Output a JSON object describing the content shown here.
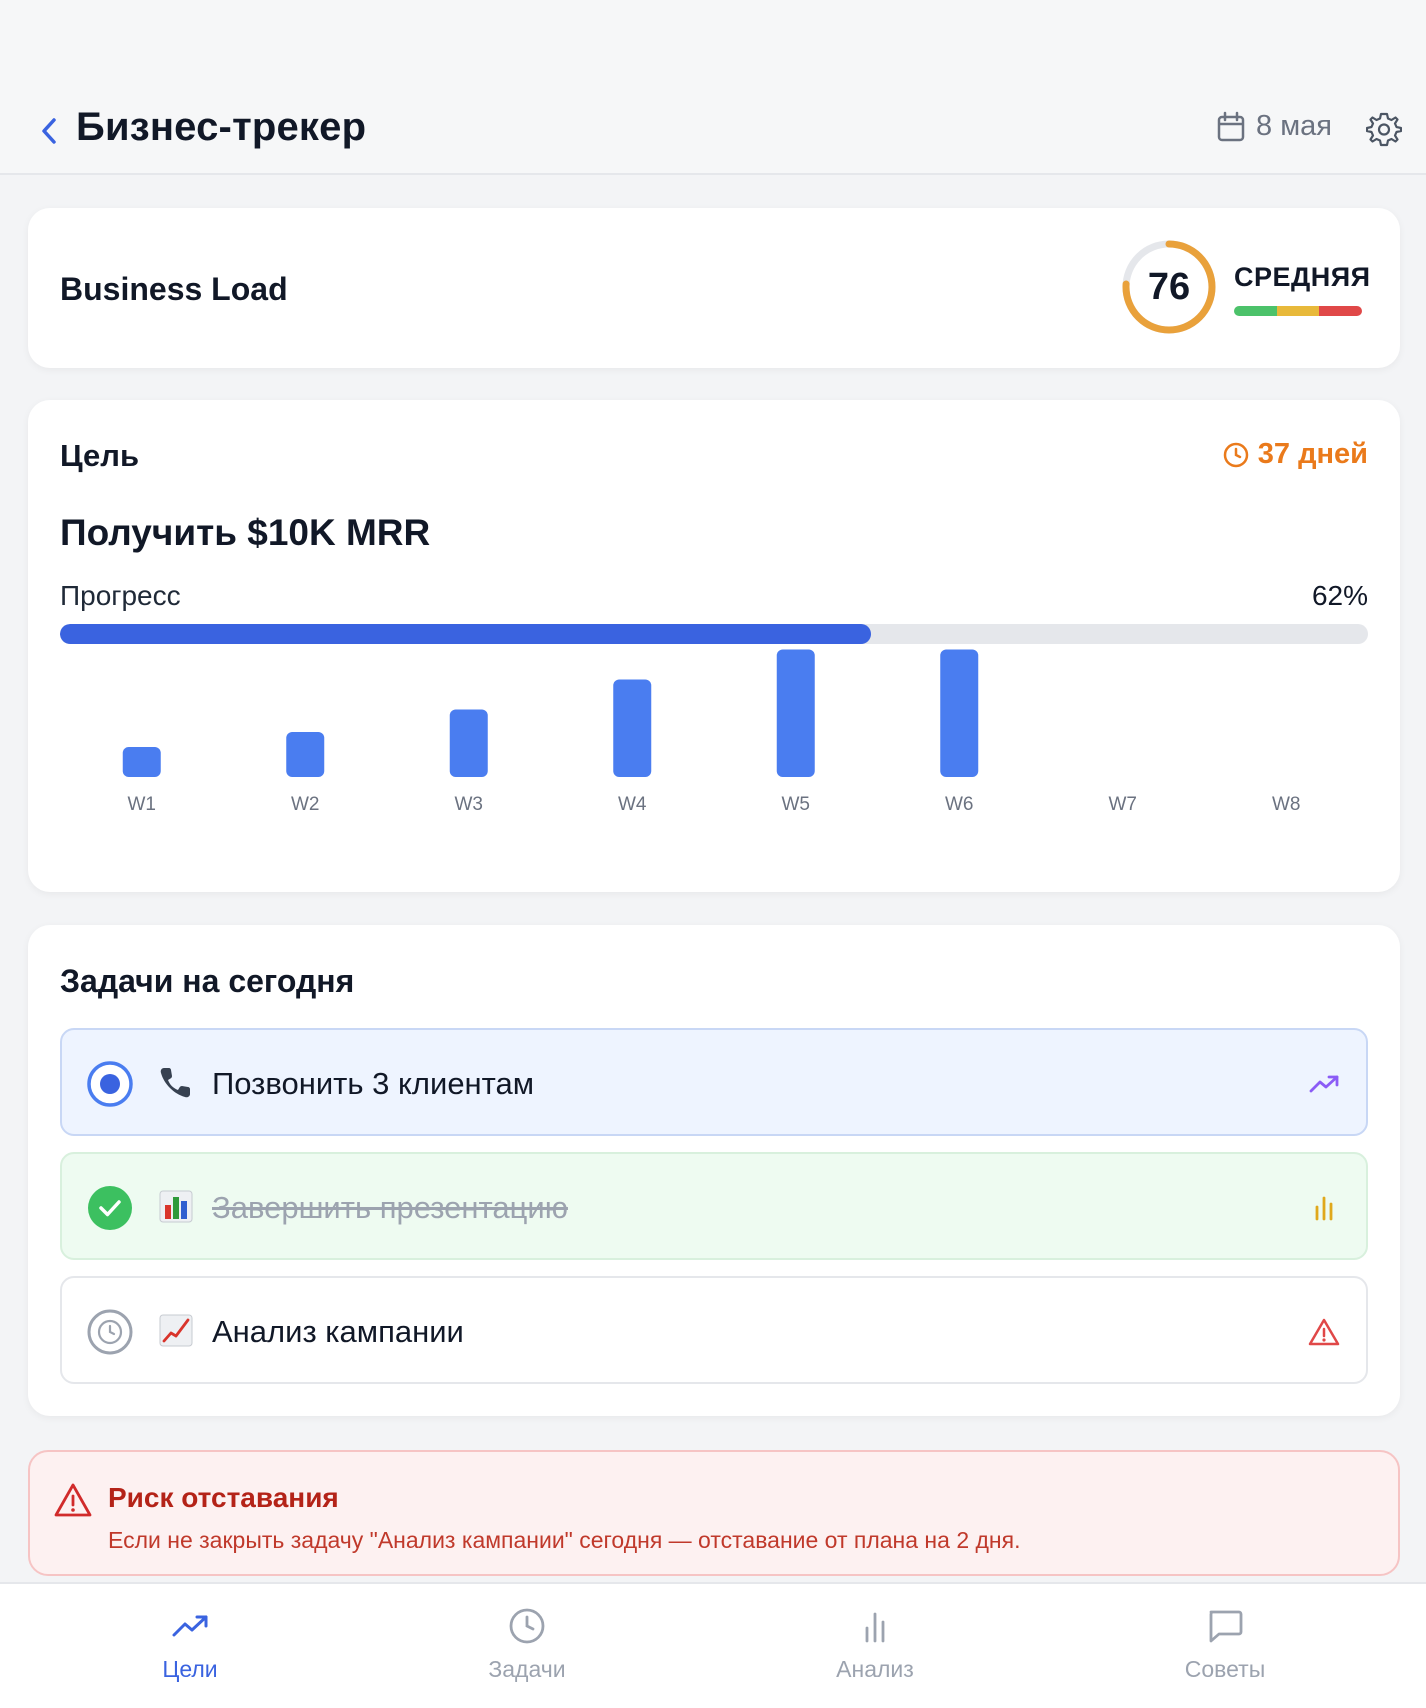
{
  "header": {
    "title": "Бизнес-трекер",
    "date": "8 мая"
  },
  "load": {
    "title": "Business Load",
    "score": "76",
    "score_value": 76,
    "score_max": 100,
    "level": "СРЕДНЯЯ",
    "colors": {
      "ring": "#e9a13b",
      "low": "#4cc26a",
      "mid": "#e8b93a",
      "high": "#e04848"
    }
  },
  "goal": {
    "label": "Цель",
    "deadline": "37 дней",
    "name": "Получить $10K MRR",
    "progress_label": "Прогресс",
    "progress_text": "62%",
    "progress": 0.62
  },
  "chart_data": {
    "type": "bar",
    "categories": [
      "W1",
      "W2",
      "W3",
      "W4",
      "W5",
      "W6",
      "W7",
      "W8"
    ],
    "values": [
      2,
      3,
      4.5,
      6.5,
      8.5,
      8.5,
      0,
      0
    ],
    "ylim": [
      0,
      10
    ],
    "color": "#4a7df0"
  },
  "tasks": {
    "title": "Задачи на сегодня",
    "items": [
      {
        "text": "Позвонить 3 клиентам",
        "status": "in-progress",
        "icon": "phone-icon",
        "badge": "trending-up-icon"
      },
      {
        "text": "Завершить презентацию",
        "status": "done",
        "icon": "bar-chart-emoji-icon",
        "badge": "bar-chart-icon"
      },
      {
        "text": "Анализ кампании",
        "status": "pending",
        "icon": "chart-increasing-emoji-icon",
        "badge": "warning-icon"
      }
    ]
  },
  "risk": {
    "title": "Риск отставания",
    "text": "Если не закрыть задачу \"Анализ кампании\" сегодня — отставание от плана на 2 дня."
  },
  "tabs": [
    {
      "label": "Цели",
      "icon": "trending-up-icon",
      "active": true
    },
    {
      "label": "Задачи",
      "icon": "clock-icon",
      "active": false
    },
    {
      "label": "Анализ",
      "icon": "bar-chart-icon",
      "active": false
    },
    {
      "label": "Советы",
      "icon": "chat-icon",
      "active": false
    }
  ]
}
